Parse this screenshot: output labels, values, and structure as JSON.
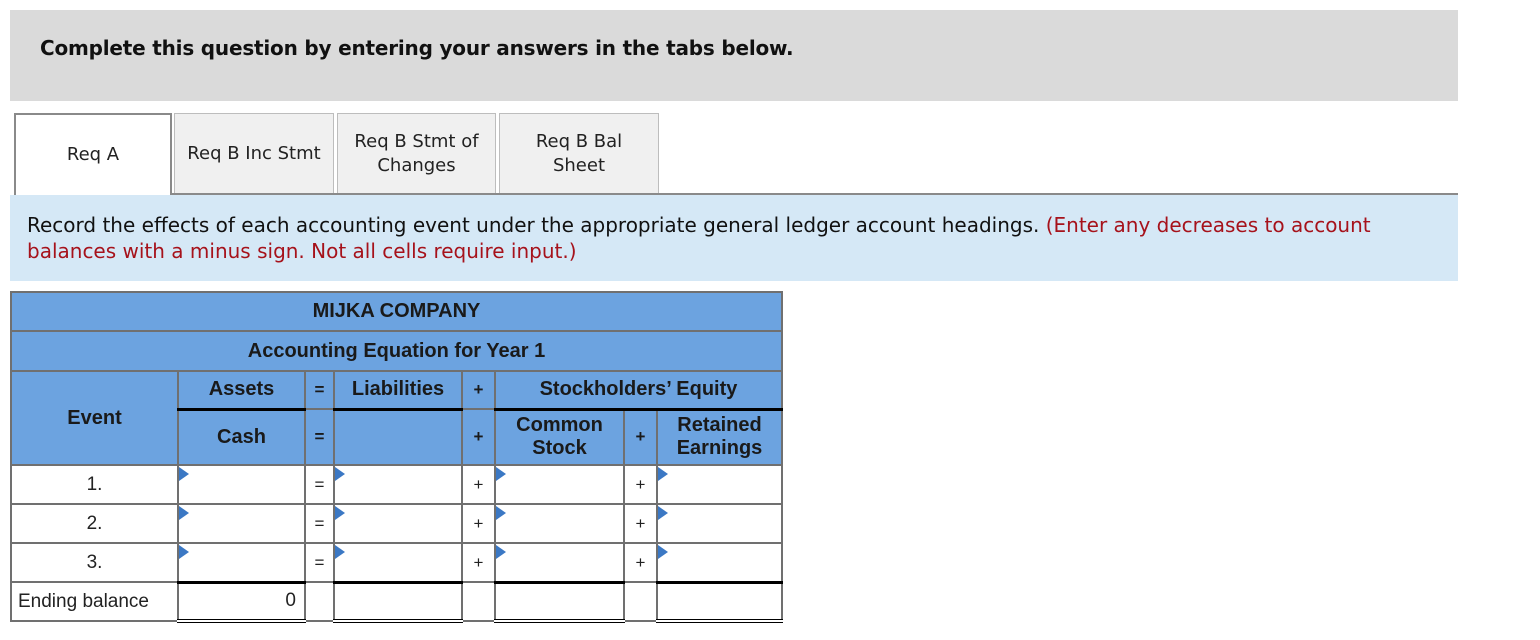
{
  "banner": {
    "text": "Complete this question by entering your answers in the tabs below."
  },
  "tabs": [
    {
      "label": "Req A",
      "active": true
    },
    {
      "label": "Req B Inc Stmt",
      "active": false
    },
    {
      "label": "Req B Stmt of Changes",
      "active": false
    },
    {
      "label": "Req B Bal Sheet",
      "active": false
    }
  ],
  "instructions": {
    "main": "Record the effects of each accounting event under the appropriate general ledger account headings. ",
    "note": "(Enter any decreases to account balances with a minus sign. Not all cells require input.)"
  },
  "table": {
    "company": "MIJKA COMPANY",
    "title": "Accounting Equation for Year 1",
    "headers": {
      "event": "Event",
      "assets": "Assets",
      "equals": "=",
      "liabilities": "Liabilities",
      "plus": "+",
      "stockholders_equity": "Stockholders’ Equity",
      "cash": "Cash",
      "common_stock_line1": "Common",
      "common_stock_line2": "Stock",
      "retained_earnings_line1": "Retained",
      "retained_earnings_line2": "Earnings"
    },
    "rows": [
      {
        "event": "1.",
        "cash": "",
        "liabilities": "",
        "common_stock": "",
        "retained_earnings": "",
        "eq": "=",
        "plus1": "+",
        "plus2": "+"
      },
      {
        "event": "2.",
        "cash": "",
        "liabilities": "",
        "common_stock": "",
        "retained_earnings": "",
        "eq": "=",
        "plus1": "+",
        "plus2": "+"
      },
      {
        "event": "3.",
        "cash": "",
        "liabilities": "",
        "common_stock": "",
        "retained_earnings": "",
        "eq": "=",
        "plus1": "+",
        "plus2": "+"
      }
    ],
    "ending": {
      "label": "Ending balance",
      "cash": "0",
      "liabilities": "",
      "common_stock": "",
      "retained_earnings": ""
    }
  },
  "colors": {
    "header_blue": "#6ca3e0",
    "instruction_bg": "#d5e8f6",
    "note_red": "#a6121b",
    "banner_gray": "#dadada",
    "marker_blue": "#3b78c4"
  }
}
